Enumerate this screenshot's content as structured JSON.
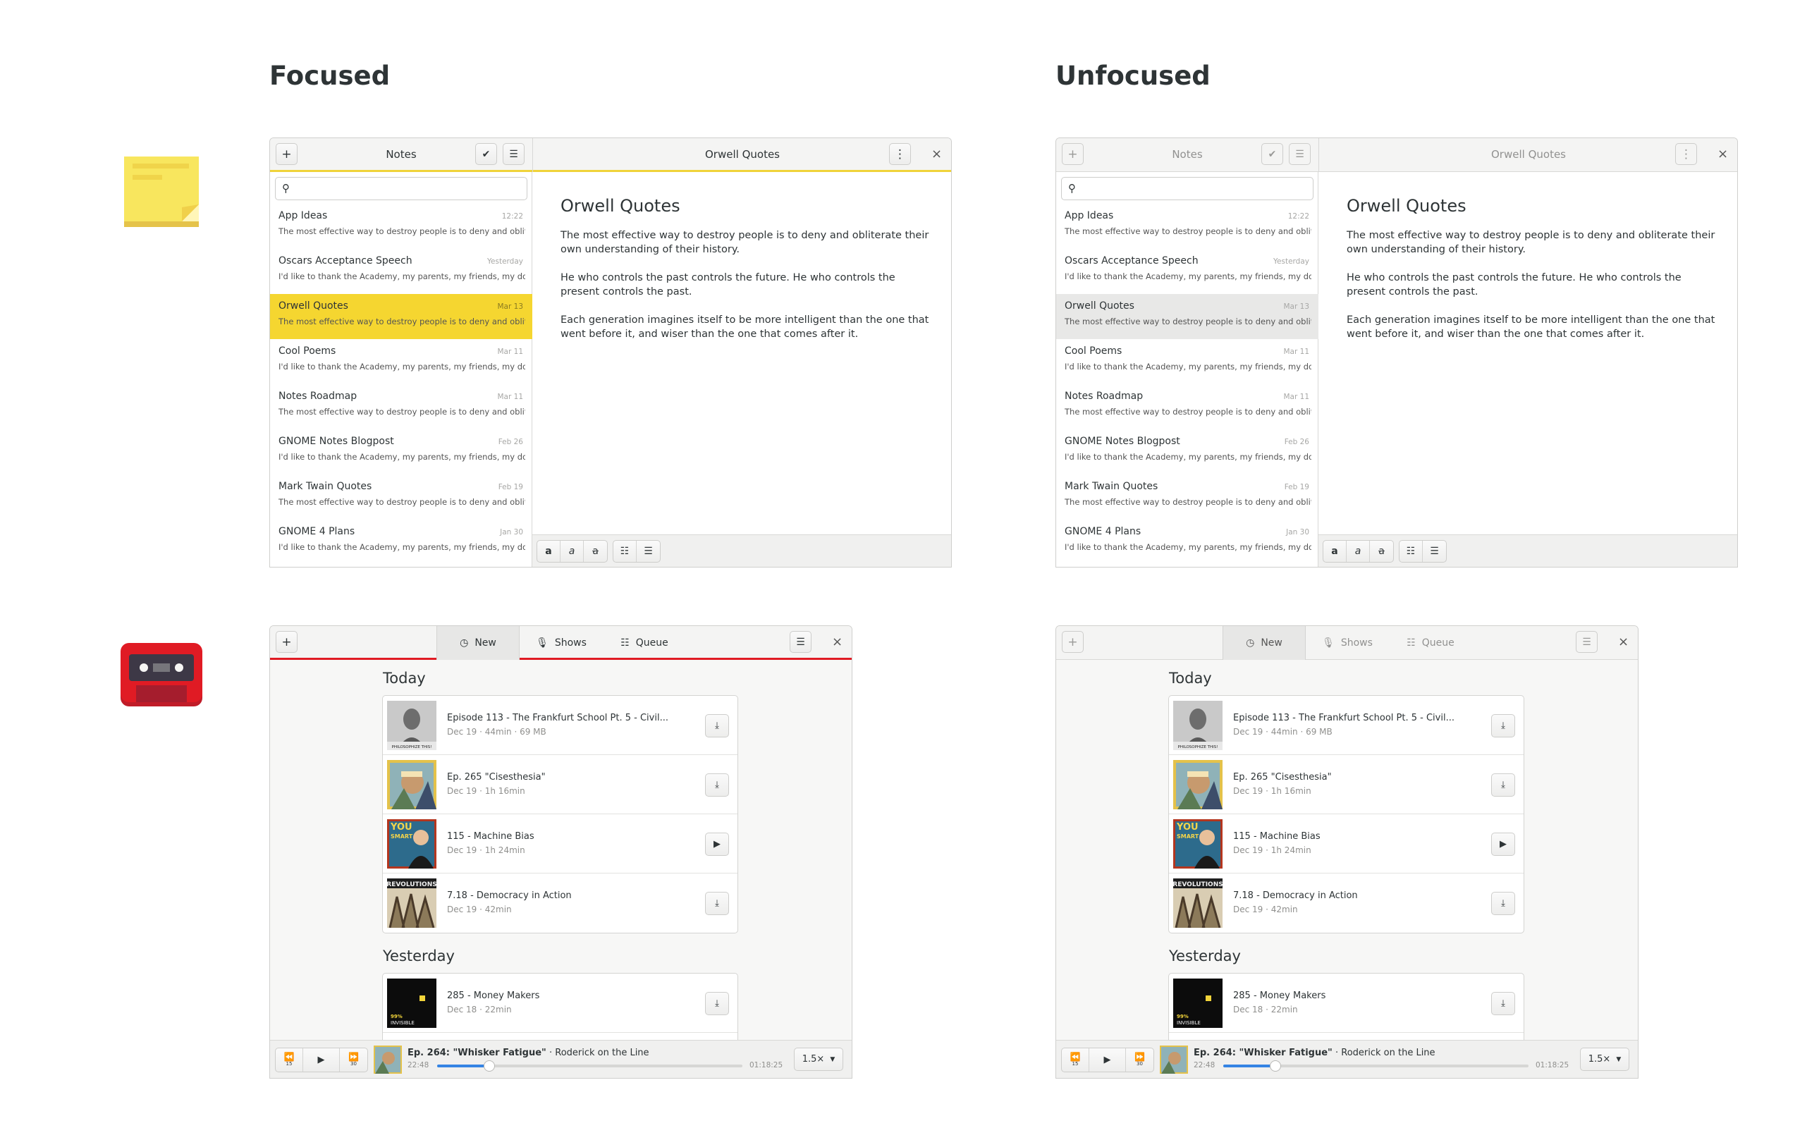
{
  "headings": {
    "focused": "Focused",
    "unfocused": "Unfocused"
  },
  "notes": {
    "add_label": "+",
    "title": "Notes",
    "check_icon": "✔",
    "menu_icon": "☰",
    "editor_title": "Orwell Quotes",
    "more_icon": "⋮",
    "close_icon": "×",
    "search_icon": "🔍",
    "items": [
      {
        "title": "App Ideas",
        "date": "12:22",
        "snippet": "The most effective way to destroy people is to deny and obliter..."
      },
      {
        "title": "Oscars Acceptance Speech",
        "date": "Yesterday",
        "snippet": "I'd like to thank the Academy, my parents, my friends, my dog..."
      },
      {
        "title": "Orwell Quotes",
        "date": "Mar 13",
        "snippet": "The most effective way to destroy people is to deny and obliter..."
      },
      {
        "title": "Cool Poems",
        "date": "Mar 11",
        "snippet": "I'd like to thank the Academy, my parents, my friends, my dog..."
      },
      {
        "title": "Notes Roadmap",
        "date": "Mar 11",
        "snippet": "The most effective way to destroy people is to deny and obliter..."
      },
      {
        "title": "GNOME Notes Blogpost",
        "date": "Feb 26",
        "snippet": "I'd like to thank the Academy, my parents, my friends, my dog..."
      },
      {
        "title": "Mark Twain Quotes",
        "date": "Feb 19",
        "snippet": "The most effective way to destroy people is to deny and obliter..."
      },
      {
        "title": "GNOME 4 Plans",
        "date": "Jan 30",
        "snippet": "I'd like to thank the Academy, my parents, my friends, my dog..."
      }
    ],
    "document": {
      "title": "Orwell Quotes",
      "paragraphs": [
        "The most effective way to destroy people is to deny and obliterate their own understanding of their history.",
        "He who controls the past controls the future. He who controls the present controls the past.",
        "Each generation imagines itself to be more intelligent than the one that went before it, and wiser than the one that comes after it."
      ]
    },
    "format_icons": {
      "bold": "a",
      "italic": "a",
      "strike": "a",
      "bullets": "☷",
      "numbered": "☰"
    }
  },
  "podcasts": {
    "add_label": "+",
    "tabs": [
      {
        "label": "New",
        "icon": "clock-icon"
      },
      {
        "label": "Shows",
        "icon": "microphone-icon"
      },
      {
        "label": "Queue",
        "icon": "list-icon"
      }
    ],
    "menu_icon": "☰",
    "close_icon": "×",
    "sections": {
      "today": "Today",
      "yesterday": "Yesterday"
    },
    "today": [
      {
        "title": "Episode 113 - The Frankfurt School Pt. 5 - Civil...",
        "meta": "Dec 19 · 44min · 69 MB",
        "action": "download-icon",
        "art_text": "PHILOSOPHIZE THIS!"
      },
      {
        "title": "Ep. 265 \"Cisesthesia\"",
        "meta": "Dec 19 · 1h 16min",
        "action": "download-icon",
        "art_text": ""
      },
      {
        "title": "115 - Machine Bias",
        "meta": "Dec 19 · 1h 24min",
        "action": "play-icon",
        "art_text": "YOU ARE NOT SMART"
      },
      {
        "title": "7.18 - Democracy in Action",
        "meta": "Dec 19 · 42min",
        "action": "download-icon",
        "art_text": "REVOLUTIONS"
      }
    ],
    "yesterday": [
      {
        "title": "285 - Money Makers",
        "meta": "Dec 18 · 22min",
        "action": "download-icon",
        "art_text": "99% INVISIBLE"
      }
    ],
    "player": {
      "rewind_label": "15",
      "forward_label": "30",
      "episode_title": "Ep. 264: \"Whisker Fatigue\"",
      "show": " · Roderick on the Line",
      "elapsed": "22:48",
      "remaining": "01:18:25",
      "progress": 0.17,
      "speed": "1.5×"
    }
  },
  "colors": {
    "notes_accent": "#f5d630",
    "podcasts_accent": "#e01b24",
    "progress": "#3584e4"
  }
}
